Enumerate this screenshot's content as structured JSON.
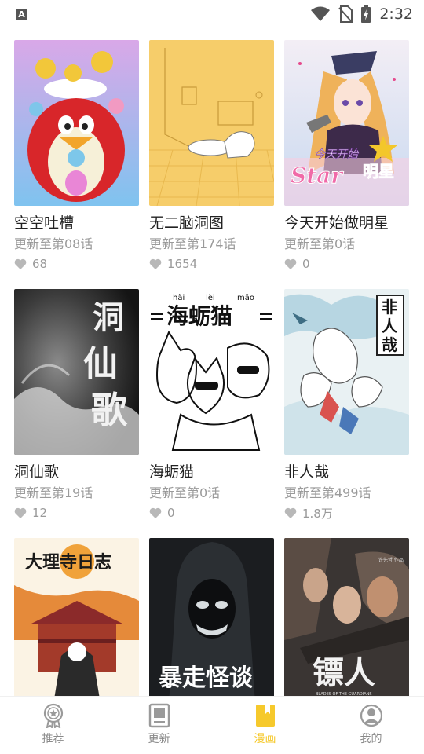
{
  "status": {
    "time": "2:32",
    "app_icon_letter": "A"
  },
  "cover_texts": {
    "c6_pinyin": [
      "hǎi",
      "lèi",
      "māo"
    ],
    "c6_title": "海蛎猫",
    "c5_calligraphy": [
      "洞",
      "仙",
      "歌"
    ],
    "c3_banner": "今天开始",
    "c3_star": "Star",
    "c3_ming": "明星",
    "c7_badge": [
      "非",
      "人",
      "哉"
    ],
    "c8_title": "大理寺日志",
    "c10_title": "暴走怪谈",
    "c11_title": "镖人",
    "c11_subtitle": "BLADES OF THE GUARDIANS",
    "c11_author": "许先哲 作品"
  },
  "comics": [
    {
      "title": "空空吐槽",
      "update": "更新至第08话",
      "likes": "68"
    },
    {
      "title": "无二脑洞图",
      "update": "更新至第174话",
      "likes": "1654"
    },
    {
      "title": "今天开始做明星",
      "update": "更新至第0话",
      "likes": "0"
    },
    {
      "title": "洞仙歌",
      "update": "更新至第19话",
      "likes": "12"
    },
    {
      "title": "海蛎猫",
      "update": "更新至第0话",
      "likes": "0"
    },
    {
      "title": "非人哉",
      "update": "更新至第499话",
      "likes": "1.8万"
    },
    {
      "title": "",
      "update": "",
      "likes": ""
    },
    {
      "title": "",
      "update": "",
      "likes": ""
    },
    {
      "title": "",
      "update": "",
      "likes": ""
    }
  ],
  "tabs": [
    {
      "label": "推荐",
      "icon": "award-icon",
      "active": false
    },
    {
      "label": "更新",
      "icon": "book-icon",
      "active": false
    },
    {
      "label": "漫画",
      "icon": "bookmark-book-icon",
      "active": true
    },
    {
      "label": "我的",
      "icon": "user-icon",
      "active": false
    }
  ],
  "colors": {
    "accent": "#f6c92c",
    "muted": "#9a9a9a",
    "title": "#222222"
  }
}
